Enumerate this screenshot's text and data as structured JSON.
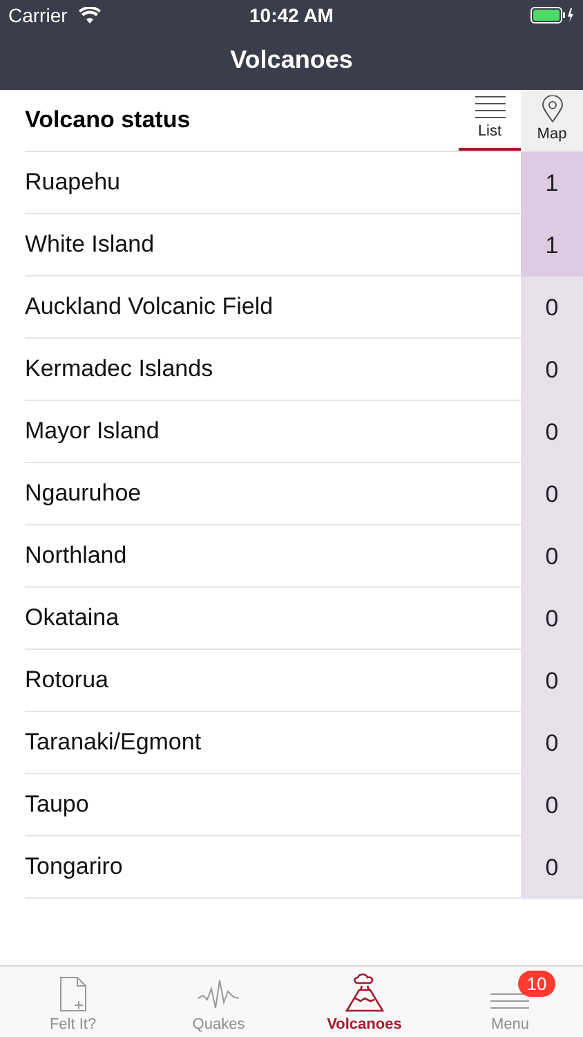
{
  "status_bar": {
    "carrier": "Carrier",
    "time": "10:42 AM"
  },
  "nav": {
    "title": "Volcanoes"
  },
  "header": {
    "title": "Volcano status",
    "views": [
      {
        "label": "List",
        "kind": "list",
        "selected": true
      },
      {
        "label": "Map",
        "kind": "map",
        "selected": false
      }
    ]
  },
  "volcanoes": [
    {
      "name": "Ruapehu",
      "level": "1",
      "color": "#dccbe1"
    },
    {
      "name": "White Island",
      "level": "1",
      "color": "#dccbe1"
    },
    {
      "name": "Auckland Volcanic Field",
      "level": "0",
      "color": "#e6dfec"
    },
    {
      "name": "Kermadec Islands",
      "level": "0",
      "color": "#e6dfec"
    },
    {
      "name": "Mayor Island",
      "level": "0",
      "color": "#e6dfec"
    },
    {
      "name": "Ngauruhoe",
      "level": "0",
      "color": "#e6dfec"
    },
    {
      "name": "Northland",
      "level": "0",
      "color": "#e6dfec"
    },
    {
      "name": "Okataina",
      "level": "0",
      "color": "#e6dfec"
    },
    {
      "name": "Rotorua",
      "level": "0",
      "color": "#e6dfec"
    },
    {
      "name": "Taranaki/Egmont",
      "level": "0",
      "color": "#e6dfec"
    },
    {
      "name": "Taupo",
      "level": "0",
      "color": "#e6dfec"
    },
    {
      "name": "Tongariro",
      "level": "0",
      "color": "#e6dfec"
    }
  ],
  "tab_bar": [
    {
      "label": "Felt It?",
      "kind": "felt",
      "selected": false
    },
    {
      "label": "Quakes",
      "kind": "quakes",
      "selected": false
    },
    {
      "label": "Volcanoes",
      "kind": "volcano",
      "selected": true
    },
    {
      "label": "Menu",
      "kind": "menu",
      "selected": false,
      "badge": "10"
    }
  ]
}
